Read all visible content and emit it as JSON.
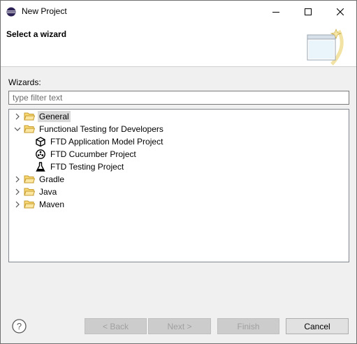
{
  "window": {
    "title": "New Project",
    "minimize_glyph": "—",
    "maximize_glyph": "☐",
    "close_glyph": "✕"
  },
  "banner": {
    "title": "Select a wizard"
  },
  "wizards": {
    "label": "Wizards:",
    "filter_placeholder": "type filter text",
    "filter_value": ""
  },
  "tree": {
    "items": [
      {
        "label": "General",
        "expanded": false,
        "icon": "folder-icon",
        "selected": true
      },
      {
        "label": "Functional Testing for Developers",
        "expanded": true,
        "icon": "folder-icon"
      },
      {
        "label": "FTD Application Model Project",
        "icon": "cube-icon"
      },
      {
        "label": "FTD Cucumber Project",
        "icon": "cucumber-icon"
      },
      {
        "label": "FTD Testing Project",
        "icon": "flask-icon"
      },
      {
        "label": "Gradle",
        "expanded": false,
        "icon": "folder-icon"
      },
      {
        "label": "Java",
        "expanded": false,
        "icon": "folder-icon"
      },
      {
        "label": "Maven",
        "expanded": false,
        "icon": "folder-icon"
      }
    ]
  },
  "buttons": {
    "help_glyph": "?",
    "back": "< Back",
    "next": "Next >",
    "finish": "Finish",
    "cancel": "Cancel"
  },
  "colors": {
    "folder": "#e8c266",
    "selection": "#d9d9d9",
    "disabled_text": "#a0a0a0"
  }
}
